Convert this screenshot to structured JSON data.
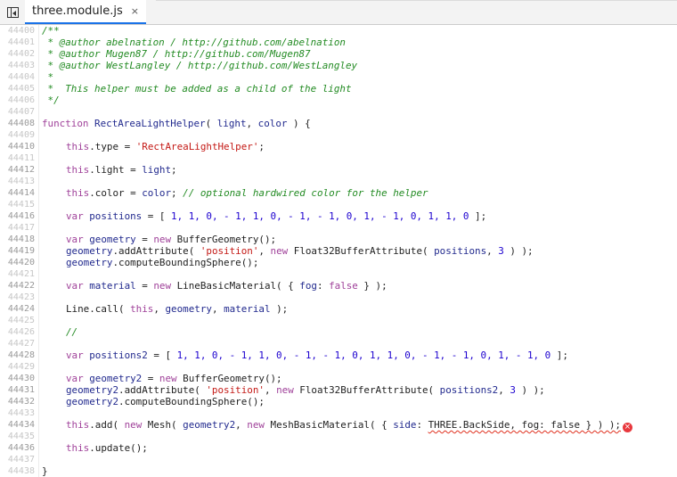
{
  "tab": {
    "title": "three.module.js",
    "close": "×"
  },
  "line_numbers": [
    "44400",
    "44401",
    "44402",
    "44403",
    "44404",
    "44405",
    "44406",
    "44407",
    "44408",
    "44409",
    "44410",
    "44411",
    "44412",
    "44413",
    "44414",
    "44415",
    "44416",
    "44417",
    "44418",
    "44419",
    "44420",
    "44421",
    "44422",
    "44423",
    "44424",
    "44425",
    "44426",
    "44427",
    "44428",
    "44429",
    "44430",
    "44431",
    "44432",
    "44433",
    "44434",
    "44435",
    "44436",
    "44437",
    "44438"
  ],
  "code": {
    "l0": "/**",
    "l1": " * @author abelnation / http://github.com/abelnation",
    "l2": " * @author Mugen87 / http://github.com/Mugen87",
    "l3": " * @author WestLangley / http://github.com/WestLangley",
    "l4": " *",
    "l5": " *  This helper must be added as a child of the light",
    "l6": " */",
    "l8": {
      "k": "function",
      "name": " RectAreaLightHelper",
      "p1": "( ",
      "v1": "light",
      "p2": ", ",
      "v2": "color",
      "p3": " ) {"
    },
    "l10": {
      "k": "this",
      "a": ".type = ",
      "s": "'RectAreaLightHelper'",
      "b": ";"
    },
    "l12": {
      "k": "this",
      "a": ".light = ",
      "v": "light",
      "b": ";"
    },
    "l14": {
      "k": "this",
      "a": ".color = ",
      "v": "color",
      "b": "; ",
      "c": "// optional hardwired color for the helper"
    },
    "l16": {
      "k": "var",
      "v": " positions",
      "eq": " = [ ",
      "vals": "1, 1, 0, - 1, 1, 0, - 1, - 1, 0, 1, - 1, 0, 1, 1, 0",
      "end": " ];"
    },
    "l18": {
      "k": "var",
      "v": " geometry",
      "eq": " = ",
      "k2": "new",
      "f": " BufferGeometry();"
    },
    "l19": {
      "v": "geometry",
      "a": ".addAttribute( ",
      "s": "'position'",
      "b": ", ",
      "k": "new",
      "f": " Float32BufferAttribute( ",
      "v2": "positions",
      "c": ", ",
      "n": "3",
      "e": " ) );"
    },
    "l20": {
      "v": "geometry",
      "a": ".computeBoundingSphere();"
    },
    "l22": {
      "k": "var",
      "v": " material",
      "eq": " = ",
      "k2": "new",
      "f": " LineBasicMaterial( { ",
      "p": "fog",
      "c": ": ",
      "k3": "false",
      "e": " } );"
    },
    "l24": {
      "a": "Line.call( ",
      "k": "this",
      "b": ", ",
      "v": "geometry",
      "c": ", ",
      "v2": "material",
      "e": " );"
    },
    "l26": {
      "c": "//"
    },
    "l28": {
      "k": "var",
      "v": " positions2",
      "eq": " = [ ",
      "vals": "1, 1, 0, - 1, 1, 0, - 1, - 1, 0, 1, 1, 0, - 1, - 1, 0, 1, - 1, 0",
      "end": " ];"
    },
    "l30": {
      "k": "var",
      "v": " geometry2",
      "eq": " = ",
      "k2": "new",
      "f": " BufferGeometry();"
    },
    "l31": {
      "v": "geometry2",
      "a": ".addAttribute( ",
      "s": "'position'",
      "b": ", ",
      "k": "new",
      "f": " Float32BufferAttribute( ",
      "v2": "positions2",
      "c": ", ",
      "n": "3",
      "e": " ) );"
    },
    "l32": {
      "v": "geometry2",
      "a": ".computeBoundingSphere();"
    },
    "l34": {
      "k": "this",
      "a": ".add( ",
      "k2": "new",
      "f": " Mesh( ",
      "v": "geometry2",
      "b": ", ",
      "k3": "new",
      "f2": " MeshBasicMaterial( { ",
      "p": "side",
      "c": ": ",
      "sq": "THREE.BackSide, fog: false } ) );",
      "k4": "false",
      "err": "×"
    },
    "l36": {
      "k": "this",
      "a": ".update();"
    },
    "l38": "}"
  },
  "colors": {
    "comment": "#238b23",
    "keyword": "#a0429a",
    "string": "#c41a16",
    "number": "#1c00cf",
    "variable": "#222a8e",
    "error": "#e8383d",
    "tab_accent": "#1a73e8"
  }
}
